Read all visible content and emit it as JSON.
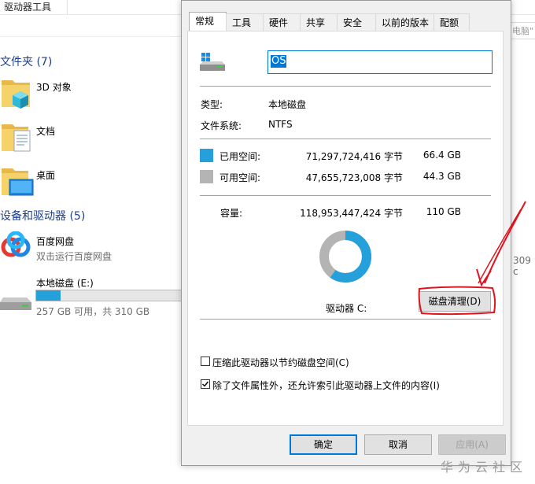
{
  "explorer": {
    "ribbon_tab": "驱动器工具",
    "search_placeholder": "电脑\"",
    "groups": [
      {
        "title": "文件夹 (7)"
      },
      {
        "title": "设备和驱动器 (5)"
      }
    ],
    "folders": [
      {
        "name": "3D 对象"
      },
      {
        "name": "文档"
      },
      {
        "name": "桌面"
      }
    ],
    "devices": [
      {
        "name": "百度网盘",
        "sub": "双击运行百度网盘"
      },
      {
        "name": "本地磁盘 (E:)",
        "sub": "257 GB 可用，共 310 GB",
        "used_fraction": 0.17
      }
    ],
    "right_partial_number": "309 c"
  },
  "dialog": {
    "tabs": [
      "常规",
      "工具",
      "硬件",
      "共享",
      "安全",
      "以前的版本",
      "配额"
    ],
    "active_tab": "常规",
    "drive_name": "OS",
    "type_label": "类型:",
    "type_value": "本地磁盘",
    "fs_label": "文件系统:",
    "fs_value": "NTFS",
    "used_label": "已用空间:",
    "used_bytes": "71,297,724,416 字节",
    "used_gb": "66.4 GB",
    "free_label": "可用空间:",
    "free_bytes": "47,655,723,008 字节",
    "free_gb": "44.3 GB",
    "capacity_label": "容量:",
    "capacity_bytes": "118,953,447,424 字节",
    "capacity_gb": "110 GB",
    "drive_letter_label": "驱动器 C:",
    "cleanup_button": "磁盘清理(D)",
    "compress_checkbox": {
      "label": "压缩此驱动器以节约磁盘空间(C)",
      "checked": false
    },
    "index_checkbox": {
      "label": "除了文件属性外，还允许索引此驱动器上文件的内容(I)",
      "checked": true
    },
    "ok_button": "确定",
    "cancel_button": "取消",
    "apply_button": "应用(A)",
    "used_fraction": 0.599,
    "colors": {
      "used": "#26a0da",
      "free": "#b4b4b4",
      "annotation": "#e0141e"
    }
  },
  "watermark": "华为云社区"
}
